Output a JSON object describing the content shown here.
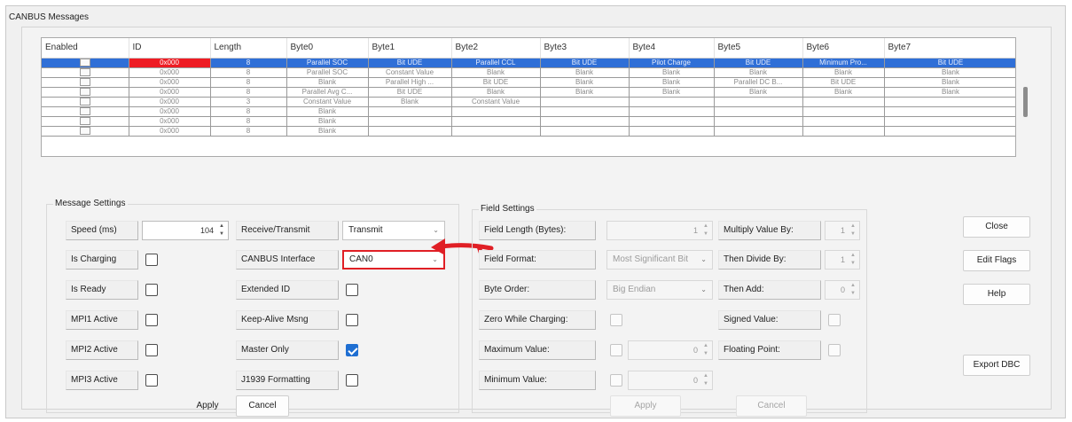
{
  "frame": {
    "title": "CANBUS Messages"
  },
  "table": {
    "columns": [
      "Enabled",
      "ID",
      "Length",
      "Byte0",
      "Byte1",
      "Byte2",
      "Byte3",
      "Byte4",
      "Byte5",
      "Byte6",
      "Byte7"
    ],
    "rows": [
      {
        "id": "0x000",
        "length": "8",
        "bytes": [
          "Parallel SOC",
          "Bit UDE",
          "Parallel CCL",
          "Bit UDE",
          "Pilot Charge",
          "Bit UDE",
          "Minimum Pro...",
          "Bit UDE"
        ],
        "selected": true
      },
      {
        "id": "0x000",
        "length": "8",
        "bytes": [
          "Parallel SOC",
          "Constant Value",
          "Blank",
          "Blank",
          "Blank",
          "Blank",
          "Blank",
          "Blank"
        ],
        "selected": false
      },
      {
        "id": "0x000",
        "length": "8",
        "bytes": [
          "Blank",
          "Parallel High ...",
          "Bit UDE",
          "Blank",
          "Blank",
          "Parallel DC B...",
          "Bit UDE",
          "Blank"
        ],
        "selected": false
      },
      {
        "id": "0x000",
        "length": "8",
        "bytes": [
          "Parallel Avg C...",
          "Bit UDE",
          "Blank",
          "Blank",
          "Blank",
          "Blank",
          "Blank",
          "Blank"
        ],
        "selected": false
      },
      {
        "id": "0x000",
        "length": "3",
        "bytes": [
          "Constant Value",
          "Blank",
          "Constant Value",
          "",
          "",
          "",
          "",
          ""
        ],
        "selected": false
      },
      {
        "id": "0x000",
        "length": "8",
        "bytes": [
          "Blank",
          "",
          "",
          "",
          "",
          "",
          "",
          ""
        ],
        "selected": false
      },
      {
        "id": "0x000",
        "length": "8",
        "bytes": [
          "Blank",
          "",
          "",
          "",
          "",
          "",
          "",
          ""
        ],
        "selected": false
      },
      {
        "id": "0x000",
        "length": "8",
        "bytes": [
          "Blank",
          "",
          "",
          "",
          "",
          "",
          "",
          ""
        ],
        "selected": false
      }
    ]
  },
  "message_settings": {
    "title": "Message Settings",
    "speed_label": "Speed (ms)",
    "speed_value": "104",
    "is_charging_label": "Is Charging",
    "is_ready_label": "Is Ready",
    "mpi1_label": "MPI1 Active",
    "mpi2_label": "MPI2 Active",
    "mpi3_label": "MPI3 Active",
    "rx_tx_label": "Receive/Transmit",
    "rx_tx_value": "Transmit",
    "interface_label": "CANBUS Interface",
    "interface_value": "CAN0",
    "extended_id_label": "Extended ID",
    "keep_alive_label": "Keep-Alive Msng",
    "master_only_label": "Master Only",
    "j1939_label": "J1939 Formatting",
    "apply_label": "Apply",
    "cancel_label": "Cancel"
  },
  "field_settings": {
    "title": "Field Settings",
    "field_length_label": "Field Length (Bytes):",
    "field_length_value": "1",
    "format_label": "Field Format:",
    "format_value": "Most Significant Bit",
    "byte_order_label": "Byte Order:",
    "byte_order_value": "Big Endian",
    "zero_while_label": "Zero While Charging:",
    "max_label": "Maximum Value:",
    "max_value": "0",
    "min_label": "Minimum Value:",
    "min_value": "0",
    "multiply_label": "Multiply Value By:",
    "multiply_value": "1",
    "divide_label": "Then Divide By:",
    "divide_value": "1",
    "add_label": "Then Add:",
    "add_value": "0",
    "signed_label": "Signed Value:",
    "floating_label": "Floating Point:",
    "apply_label": "Apply",
    "cancel_label": "Cancel"
  },
  "side_buttons": {
    "close": "Close",
    "edit_flags": "Edit Flags",
    "help": "Help",
    "export_dbc": "Export DBC"
  },
  "colors": {
    "selection": "#2f6fd7",
    "selected_id": "#ee1c24",
    "annotation": "#e01f25"
  }
}
